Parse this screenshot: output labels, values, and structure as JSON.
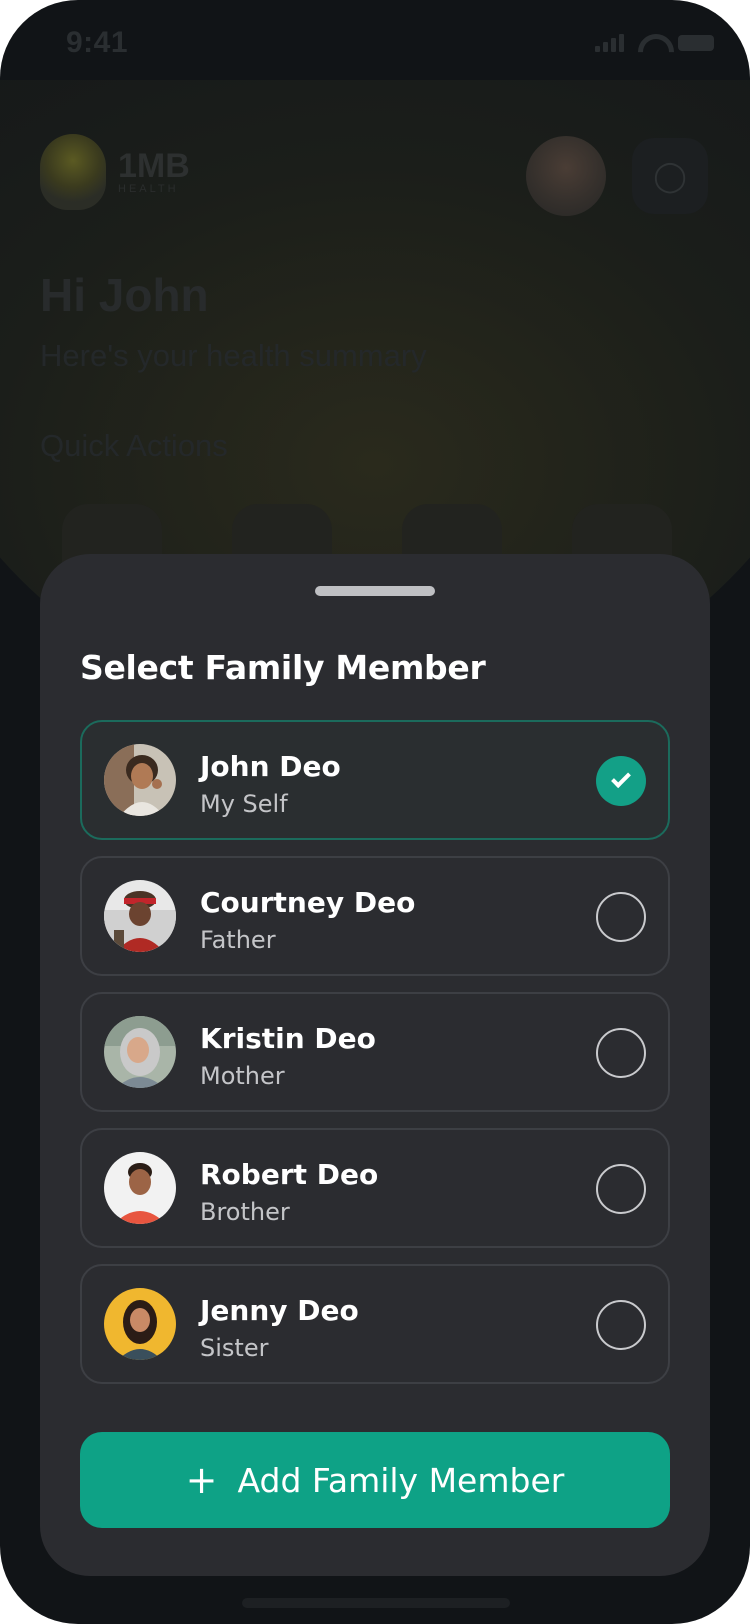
{
  "status_bar": {
    "time": "9:41"
  },
  "background": {
    "logo_text": "1MB",
    "logo_sub": "HEALTH",
    "greeting": "Hi John",
    "subtitle": "Here's your health summary",
    "section": "Quick Actions"
  },
  "sheet": {
    "title": "Select Family Member",
    "members": [
      {
        "name": "John Deo",
        "relation": "My Self",
        "selected": true
      },
      {
        "name": "Courtney Deo",
        "relation": "Father",
        "selected": false
      },
      {
        "name": "Kristin Deo",
        "relation": "Mother",
        "selected": false
      },
      {
        "name": "Robert Deo",
        "relation": "Brother",
        "selected": false
      },
      {
        "name": "Jenny Deo",
        "relation": "Sister",
        "selected": false
      }
    ],
    "add_button": {
      "icon": "plus-icon",
      "label": "Add Family Member"
    }
  },
  "colors": {
    "accent": "#0ea286",
    "sheet_bg": "#2b2c30",
    "selected_border": "#1b6b5c"
  }
}
